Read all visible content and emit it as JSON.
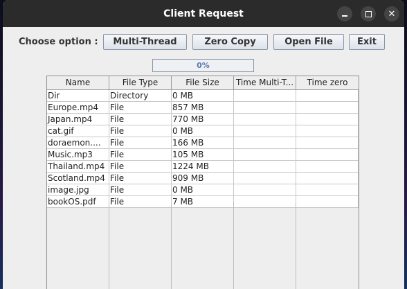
{
  "window": {
    "title": "Client Request",
    "minimize_glyph": "",
    "maximize_glyph": "",
    "close_glyph": "✕"
  },
  "toolbar": {
    "choose_label": "Choose option :",
    "multi_thread": "Multi-Thread",
    "zero_copy": "Zero Copy",
    "open_file": "Open File",
    "exit": "Exit"
  },
  "progress": {
    "value": 0,
    "text": "0%"
  },
  "table": {
    "headers": [
      "Name",
      "File Type",
      "File Size",
      "Time Multi-T...",
      "Time zero"
    ],
    "rows": [
      [
        "Dir",
        "Directory",
        "0 MB",
        "",
        ""
      ],
      [
        "Europe.mp4",
        "File",
        "857 MB",
        "",
        ""
      ],
      [
        "Japan.mp4",
        "File",
        "770 MB",
        "",
        ""
      ],
      [
        "cat.gif",
        "File",
        "0 MB",
        "",
        ""
      ],
      [
        "doraemon....",
        "File",
        "166 MB",
        "",
        ""
      ],
      [
        "Music.mp3",
        "File",
        "105 MB",
        "",
        ""
      ],
      [
        "Thailand.mp4",
        "File",
        "1224 MB",
        "",
        ""
      ],
      [
        "Scotland.mp4",
        "File",
        "909 MB",
        "",
        ""
      ],
      [
        "image.jpg",
        "File",
        "0 MB",
        "",
        ""
      ],
      [
        "bookOS.pdf",
        "File",
        "7 MB",
        "",
        ""
      ]
    ]
  }
}
